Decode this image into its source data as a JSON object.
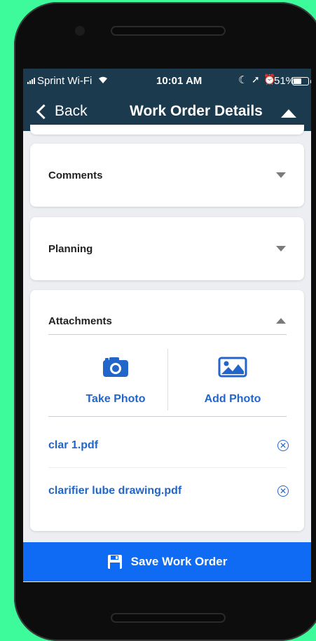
{
  "status_bar": {
    "carrier": "Sprint Wi-Fi",
    "time": "10:01 AM",
    "battery_percent": "51%",
    "battery_level": 0.51
  },
  "header": {
    "back_label": "Back",
    "title": "Work Order Details"
  },
  "sections": {
    "comments": {
      "title": "Comments"
    },
    "planning": {
      "title": "Planning"
    },
    "attachments": {
      "title": "Attachments",
      "take_photo_label": "Take Photo",
      "add_photo_label": "Add Photo",
      "files": [
        {
          "name": "clar 1.pdf"
        },
        {
          "name": "clarifier lube drawing.pdf"
        }
      ]
    }
  },
  "footer": {
    "save_label": "Save Work Order"
  },
  "icons": {
    "back": "chevron-left-icon",
    "collapse": "caret-up-icon",
    "expand": "caret-down-icon",
    "camera": "camera-icon",
    "image": "image-icon",
    "remove": "close-circle-icon",
    "save": "floppy-disk-icon"
  },
  "colors": {
    "background": "#3dfa9a",
    "header": "#1b3a4e",
    "accent": "#2266c9",
    "save_button": "#0f6bf4"
  }
}
